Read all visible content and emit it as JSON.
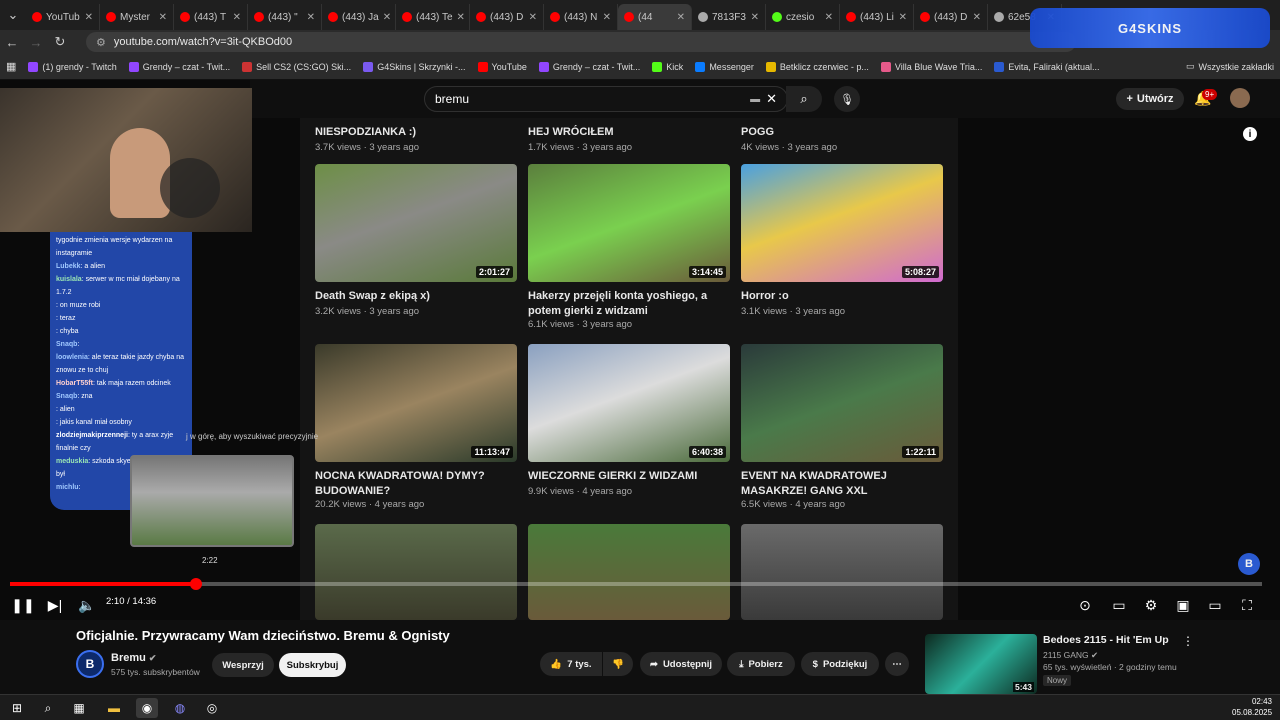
{
  "browser": {
    "tabs": [
      {
        "label": "YouTub",
        "color": "#ff0000"
      },
      {
        "label": "Myster",
        "color": "#ff0000"
      },
      {
        "label": "(443) T",
        "color": "#ff0000"
      },
      {
        "label": "(443) \"",
        "color": "#ff0000"
      },
      {
        "label": "(443) Ja",
        "color": "#ff0000"
      },
      {
        "label": "(443) Te",
        "color": "#ff0000"
      },
      {
        "label": "(443) D",
        "color": "#ff0000"
      },
      {
        "label": "(443) N",
        "color": "#ff0000"
      },
      {
        "label": "(44",
        "color": "#ff0000"
      },
      {
        "label": "7813F3",
        "color": "#aaaaaa"
      },
      {
        "label": "czesio",
        "color": "#53fc18"
      },
      {
        "label": "(443) Li",
        "color": "#ff0000"
      },
      {
        "label": "(443) D",
        "color": "#ff0000"
      },
      {
        "label": "62e58",
        "color": "#aaaaaa"
      }
    ],
    "url": "youtube.com/watch?v=3it-QKBOd00",
    "bookmarks": [
      {
        "label": "(1) grendy - Twitch",
        "color": "#9146ff"
      },
      {
        "label": "Grendy – czat - Twit...",
        "color": "#9146ff"
      },
      {
        "label": "Sell CS2 (CS:GO) Ski...",
        "color": "#cc3333"
      },
      {
        "label": "G4Skins | Skrzynki -...",
        "color": "#7a5af0"
      },
      {
        "label": "YouTube",
        "color": "#ff0000"
      },
      {
        "label": "Grendy – czat - Twit...",
        "color": "#9146ff"
      },
      {
        "label": "Kick",
        "color": "#53fc18"
      },
      {
        "label": "Messenger",
        "color": "#0a7cff"
      },
      {
        "label": "Betklicz czerwiec - p...",
        "color": "#e6b800"
      },
      {
        "label": "Villa Blue Wave Tria...",
        "color": "#e65a8a"
      },
      {
        "label": "Evita, Faliraki (aktual...",
        "color": "#2a5ad0"
      }
    ],
    "all_bookmarks": "Wszystkie zakładki",
    "overlay_logo": "G4SKINS"
  },
  "youtube": {
    "search_value": "bremu",
    "create_label": "Utwórz",
    "notif_count": "9+"
  },
  "grid": {
    "top_row": [
      {
        "title": "NIESPODZIANKA :)",
        "meta": "3.7K views · 3 years ago"
      },
      {
        "title": "HEJ WRÓCIŁEM",
        "meta": "1.7K views · 3 years ago"
      },
      {
        "title": "POGG",
        "meta": "4K views · 3 years ago"
      }
    ],
    "videos": [
      {
        "duration": "2:01:27",
        "title": "Death Swap z ekipą x)",
        "meta": "3.2K views · 3 years ago",
        "bg": "linear-gradient(160deg,#6d8f46,#8a8a86 45%,#5a7a3a)"
      },
      {
        "duration": "3:14:45",
        "title": "Hakerzy przejęli konta yoshiego, a potem gierki z widzami",
        "meta": "6.1K views · 3 years ago",
        "bg": "linear-gradient(160deg,#5b7f3d,#7ad04f 50%,#6a5a3a)"
      },
      {
        "duration": "5:08:27",
        "title": "Horror :o",
        "meta": "3.1K views · 3 years ago",
        "bg": "linear-gradient(160deg,#4aa0e0,#e8c84a 45%,#d06ad0)"
      },
      {
        "duration": "11:13:47",
        "title": "NOCNA KWADRATOWA! DYMY? BUDOWANIE?",
        "meta": "20.2K views · 4 years ago",
        "bg": "linear-gradient(160deg,#3a3a2a,#9a8460 50%,#2a3a2a)"
      },
      {
        "duration": "6:40:38",
        "title": "WIECZORNE GIERKI Z WIDZAMI",
        "meta": "9.9K views · 4 years ago",
        "bg": "linear-gradient(160deg,#8aa0c0,#dcdcdc 45%,#4a6a3a)"
      },
      {
        "duration": "1:22:11",
        "title": "EVENT NA KWADRATOWEJ MASAKRZE! GANG XXL",
        "meta": "6.5K views · 4 years ago",
        "bg": "linear-gradient(160deg,#2a3a3a,#4a7a4a 50%,#6a5a3a)"
      }
    ]
  },
  "stream": {
    "chat": [
      {
        "user": "",
        "text": "tygodnie zmienia wersje wydarzen na instagramie",
        "color": "#ffffff"
      },
      {
        "user": "Lubekk",
        "text": ": a alien",
        "color": "#a0c8ff"
      },
      {
        "user": "kuislala",
        "text": ": serwer w mc miał dojebany na 1.7.2",
        "color": "#9ae6b4"
      },
      {
        "user": "",
        "text": ": on muze robi",
        "color": "#ff6a6a"
      },
      {
        "user": "",
        "text": ": teraz",
        "color": "#ff6a6a"
      },
      {
        "user": "",
        "text": ": chyba",
        "color": "#ff6a6a"
      },
      {
        "user": "Snaqb",
        "text": ":",
        "color": "#a0c8ff"
      },
      {
        "user": "loowlenia",
        "text": ": ale teraz takie jazdy chyba na znowu ze to chuj",
        "color": "#a0c8ff"
      },
      {
        "user": "HobarT55ft",
        "text": ": tak maja razem odcinek",
        "color": "#ffd0d0"
      },
      {
        "user": "Snaqb",
        "text": ": zna",
        "color": "#a0c8ff"
      },
      {
        "user": "",
        "text": ": alien",
        "color": "#ff6a6a"
      },
      {
        "user": "",
        "text": ": jakis kanal miał osobny",
        "color": "#ff6a6a"
      },
      {
        "user": "zlodziejmakiprzenneji",
        "text": ": ty a arax zyje finalnie czy",
        "color": "#ffffff"
      },
      {
        "user": "meduskia",
        "text": ": szkoda skyena bo dobry ziom był",
        "color": "#9ae6b4"
      },
      {
        "user": "michlu",
        "text": ":",
        "color": "#a0c8ff"
      }
    ],
    "pip_caption": "j w górę, aby wyszukiwać precyzyjnie"
  },
  "player": {
    "current": "2:10",
    "total": "14:36",
    "hover_time": "2:22",
    "progress": 0.148
  },
  "video": {
    "title": "Oficjalnie. Przywracamy Wam dzieciństwo. Bremu & Ognisty",
    "channel": "Bremu",
    "channel_initial": "B",
    "subscribers": "575 tys. subskrybentów",
    "support": "Wesprzyj",
    "subscribe": "Subskrybuj",
    "likes": "7 tys.",
    "share": "Udostępnij",
    "download": "Pobierz",
    "thanks": "Podziękuj"
  },
  "next": {
    "title": "Bedoes 2115 - Hit 'Em Up",
    "channel": "2115 GANG",
    "meta": "65 tys. wyświetleń · 2 godziny temu",
    "badge": "Nowy",
    "duration": "5:43"
  },
  "taskbar": {
    "time": "02:43",
    "date": "05.08.2025"
  }
}
